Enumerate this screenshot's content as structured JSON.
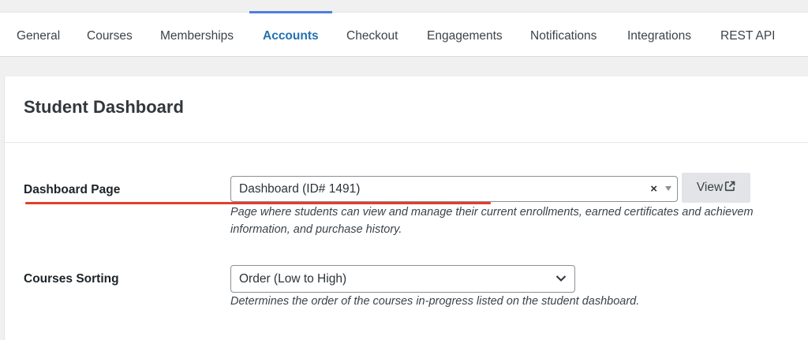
{
  "tabs": [
    {
      "label": "General"
    },
    {
      "label": "Courses"
    },
    {
      "label": "Memberships"
    },
    {
      "label": "Accounts"
    },
    {
      "label": "Checkout"
    },
    {
      "label": "Engagements"
    },
    {
      "label": "Notifications"
    },
    {
      "label": "Integrations"
    },
    {
      "label": "REST API"
    }
  ],
  "active_tab": "Accounts",
  "section": {
    "title": "Student Dashboard"
  },
  "dashboard_page": {
    "label": "Dashboard Page",
    "selected": "Dashboard (ID# 1491)",
    "view_label": "View",
    "description_line1": "Page where students can view and manage their current enrollments, earned certificates and achievem",
    "description_line2": "information, and purchase history."
  },
  "courses_sorting": {
    "label": "Courses Sorting",
    "selected": "Order (Low to High)",
    "description": "Determines the order of the courses in-progress listed on the student dashboard."
  },
  "colors": {
    "accent": "#2271b1",
    "annotation": "#e0402a"
  },
  "icons": {
    "clear": "close-icon",
    "dropdown": "caret-down-icon",
    "external_link": "external-link-icon",
    "chevron": "chevron-down-icon"
  }
}
